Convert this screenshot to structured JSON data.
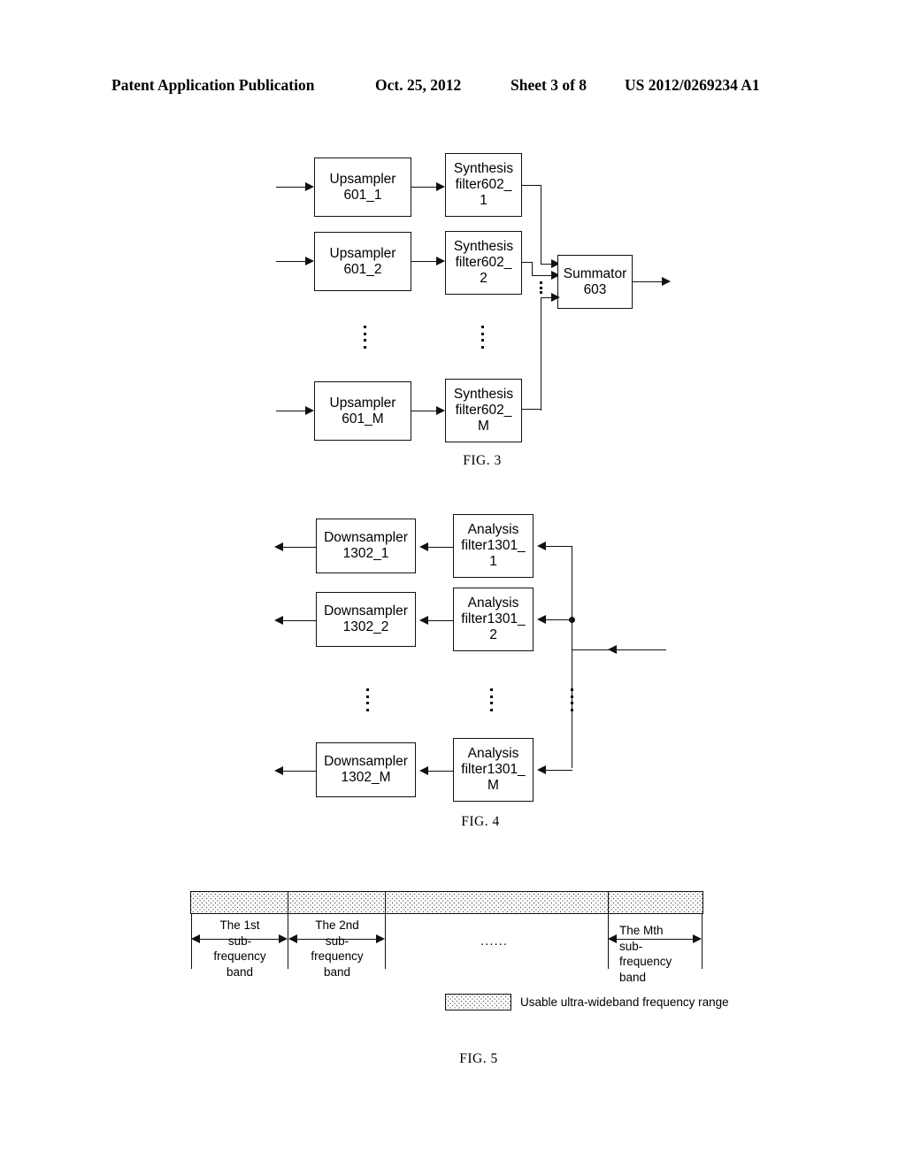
{
  "header": {
    "publication": "Patent Application Publication",
    "date": "Oct. 25, 2012",
    "sheet": "Sheet 3 of 8",
    "patent_number": "US 2012/0269234 A1"
  },
  "figures": [
    {
      "caption": "FIG. 3",
      "rows": [
        {
          "upsampler": {
            "line1": "Upsampler",
            "line2": "601_1"
          },
          "filter": {
            "line1": "Synthesis",
            "line2": "filter602_",
            "line3": "1"
          }
        },
        {
          "upsampler": {
            "line1": "Upsampler",
            "line2": "601_2"
          },
          "filter": {
            "line1": "Synthesis",
            "line2": "filter602_",
            "line3": "2"
          }
        },
        {
          "upsampler": {
            "line1": "Upsampler",
            "line2": "601_M"
          },
          "filter": {
            "line1": "Synthesis",
            "line2": "filter602_",
            "line3": "M"
          }
        }
      ],
      "summator": {
        "line1": "Summator",
        "line2": "603"
      }
    },
    {
      "caption": "FIG. 4",
      "rows": [
        {
          "downsampler": {
            "line1": "Downsampler",
            "line2": "1302_1"
          },
          "filter": {
            "line1": "Analysis",
            "line2": "filter1301_",
            "line3": "1"
          }
        },
        {
          "downsampler": {
            "line1": "Downsampler",
            "line2": "1302_2"
          },
          "filter": {
            "line1": "Analysis",
            "line2": "filter1301_",
            "line3": "2"
          }
        },
        {
          "downsampler": {
            "line1": "Downsampler",
            "line2": "1302_M"
          },
          "filter": {
            "line1": "Analysis",
            "line2": "filter1301_",
            "line3": "M"
          }
        }
      ]
    },
    {
      "caption": "FIG. 5",
      "bands": [
        {
          "r1": "The 1st",
          "r2": "sub-",
          "r3": "frequency",
          "r4": "band"
        },
        {
          "r1": "The 2nd",
          "r2": "sub-",
          "r3": "frequency",
          "r4": "band"
        },
        {
          "r1": "The Mth",
          "r2": "sub-",
          "r3": "frequency",
          "r4": "band"
        }
      ],
      "ellipsis": "......",
      "legend": {
        "label": "Usable ultra-wideband frequency range"
      }
    }
  ]
}
